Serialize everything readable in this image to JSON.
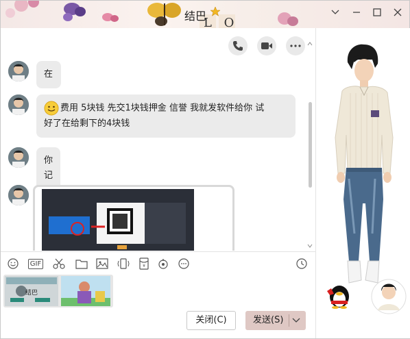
{
  "window": {
    "title": "结巴",
    "title_letters": "L  O",
    "controls": {
      "minimize": "minimize",
      "maximize": "maximize",
      "close": "close"
    }
  },
  "messages": [
    {
      "text": "在"
    },
    {
      "line1": "费用   5块钱  先交1块钱押金     信誉    我就发软件给你   试",
      "line2": "好了在给剩下的4块钱"
    },
    {
      "text": "你记得我会坑你一块钱吗"
    }
  ],
  "toolbar": {
    "gif_label": "GIF",
    "icons": [
      "smiley-icon",
      "gif-icon",
      "scissors-icon",
      "folder-icon",
      "image-icon",
      "shake-icon",
      "red-packet-icon",
      "music-icon",
      "more-icon",
      "history-icon"
    ]
  },
  "buttons": {
    "close_label": "关闭(C)",
    "send_label": "发送(S)"
  },
  "thumb_caption": "结巴",
  "colors": {
    "accent": "#dfc8c4",
    "bubble": "#ebebeb"
  }
}
